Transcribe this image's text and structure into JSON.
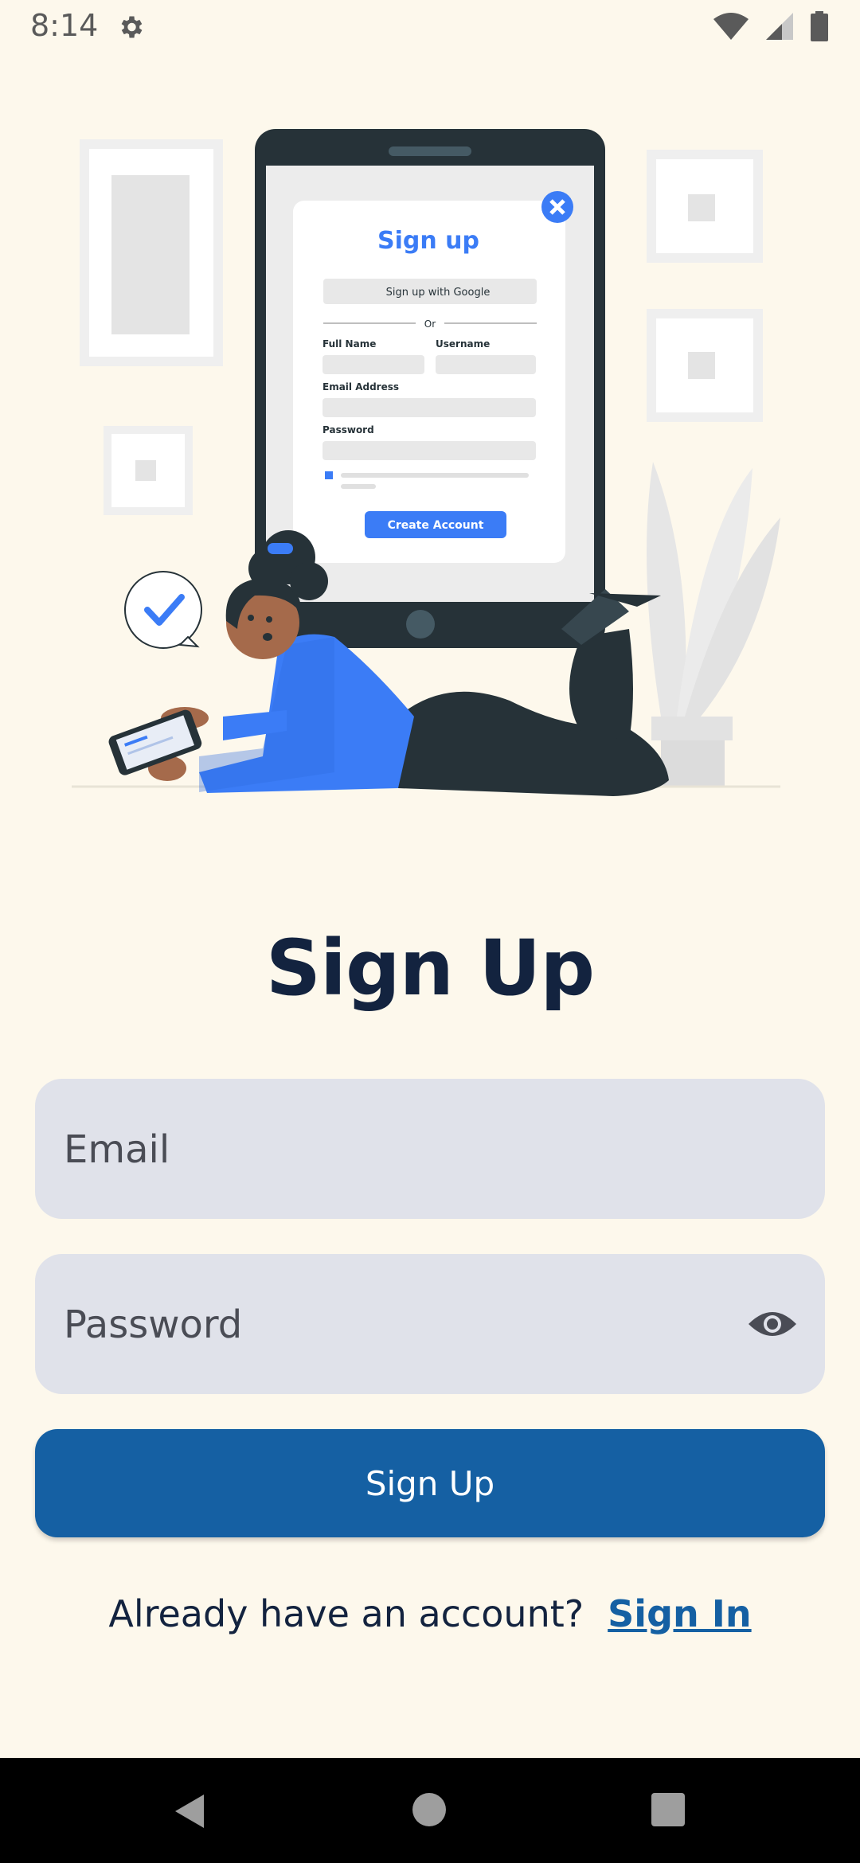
{
  "status_bar": {
    "time": "8:14"
  },
  "illustration": {
    "tablet_title": "Sign up",
    "google_button": "Sign up with Google",
    "divider": "Or",
    "full_name_label": "Full Name",
    "username_label": "Username",
    "email_label": "Email Address",
    "password_label": "Password",
    "create_button": "Create Account"
  },
  "page": {
    "title": "Sign Up",
    "email_placeholder": "Email",
    "password_placeholder": "Password",
    "signup_button": "Sign Up",
    "already_text": "Already have an account?",
    "signin_link": "Sign In"
  },
  "colors": {
    "background": "#fdf8ec",
    "primary": "#1560a3",
    "title": "#13233f",
    "field": "#e0e2ea",
    "illustration_accent": "#3b7cf6"
  }
}
